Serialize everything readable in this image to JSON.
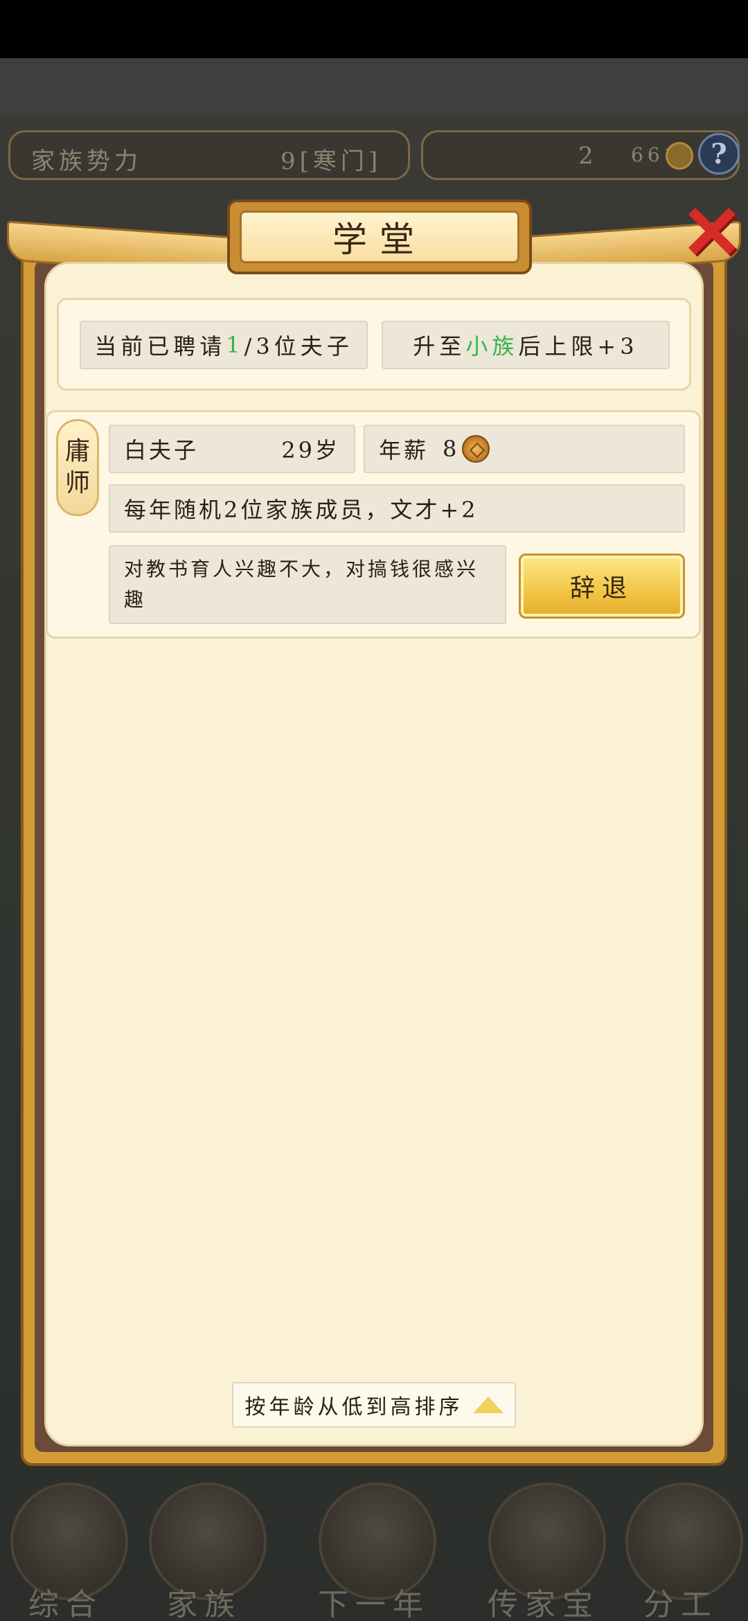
{
  "hud": {
    "family_power_label": "家族势力",
    "family_power_value": "9[寒门]",
    "resource_count": "2",
    "coin_count": "661",
    "help_label": "?"
  },
  "dialog": {
    "title": "学堂",
    "close_label": "✕",
    "hired_prefix": "当前已聘请",
    "hired_current": "1",
    "hired_suffix": "/3位夫子",
    "upgrade_prefix": "升至",
    "upgrade_rank": "小族",
    "upgrade_suffix": "后上限+3",
    "teacher": {
      "rank_char1": "庸",
      "rank_char2": "师",
      "name": "白夫子",
      "age": "29岁",
      "salary_label": "年薪",
      "salary_value": "8",
      "effect": "每年随机2位家族成员，文才+2",
      "personality": "对教书育人兴趣不大，对搞钱很感兴趣",
      "dismiss_label": "辞退"
    },
    "sort_label": "按年龄从低到高排序"
  },
  "nav": {
    "items": [
      {
        "label": "综合"
      },
      {
        "label": "家族"
      },
      {
        "label": "下一年"
      },
      {
        "label": "传家宝"
      },
      {
        "label": "分工"
      }
    ]
  },
  "colors": {
    "accent_gold": "#f2c545",
    "green_text": "#36b34a",
    "close_red": "#d62b27",
    "panel_bg": "#fbf2d6"
  }
}
